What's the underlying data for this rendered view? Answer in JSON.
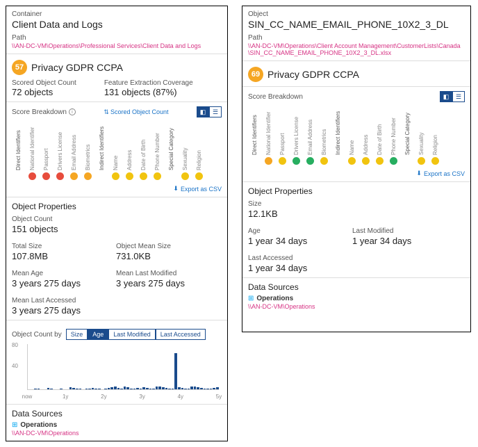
{
  "left": {
    "type_label": "Container",
    "title": "Client Data and Logs",
    "path_label": "Path",
    "path": "\\\\AN-DC-VM\\Operations\\Professional Services\\Client Data and Logs",
    "score": "57",
    "score_title": "Privacy GDPR CCPA",
    "scored_objects_label": "Scored Object Count",
    "scored_objects_value": "72 objects",
    "feature_coverage_label": "Feature Extraction Coverage",
    "feature_coverage_value": "131 objects  (87%)",
    "breakdown_label": "Score Breakdown",
    "sort_label": "Scored Object Count",
    "export_label": "Export as CSV",
    "groups": [
      {
        "group": "Direct Identifiers",
        "items": [
          {
            "label": "National Identifier",
            "color": "red"
          },
          {
            "label": "Passport",
            "color": "red"
          },
          {
            "label": "Drivers License",
            "color": "red"
          },
          {
            "label": "Email Address",
            "color": "orange"
          },
          {
            "label": "Biometrics",
            "color": "orange"
          }
        ]
      },
      {
        "group": "Indirect Identifiers",
        "items": [
          {
            "label": "Name",
            "color": "yellow"
          },
          {
            "label": "Address",
            "color": "yellow"
          },
          {
            "label": "Date of Birth",
            "color": "yellow"
          },
          {
            "label": "Phone Number",
            "color": "yellow"
          }
        ]
      },
      {
        "group": "Special Category",
        "items": [
          {
            "label": "Sexuality",
            "color": "yellow"
          },
          {
            "label": "Religion",
            "color": "yellow"
          }
        ]
      }
    ],
    "props_title": "Object Properties",
    "props": [
      {
        "lbl": "Object Count",
        "val": "151 objects"
      },
      {
        "lbl": "",
        "val": ""
      },
      {
        "lbl": "Total Size",
        "val": "107.8MB"
      },
      {
        "lbl": "Object Mean Size",
        "val": "731.0KB"
      },
      {
        "lbl": "Mean Age",
        "val": "3 years 275 days"
      },
      {
        "lbl": "Mean Last Modified",
        "val": "3 years 275 days"
      },
      {
        "lbl": "Mean Last Accessed",
        "val": "3 years 275 days"
      }
    ],
    "count_by_label": "Object Count by",
    "count_by_options": [
      "Size",
      "Age",
      "Last Modified",
      "Last Accessed"
    ],
    "count_by_active": 1,
    "ds_title": "Data Sources",
    "ds_name": "Operations",
    "ds_path": "\\\\AN-DC-VM\\Operations"
  },
  "right": {
    "type_label": "Object",
    "title": "SIN_CC_NAME_EMAIL_PHONE_10X2_3_DL",
    "path_label": "Path",
    "path": "\\\\AN-DC-VM\\Operations\\Client Account Management\\CustomerLists\\Canada\\SIN_CC_NAME_EMAIL_PHONE_10X2_3_DL.xlsx",
    "score": "69",
    "score_title": "Privacy GDPR CCPA",
    "breakdown_label": "Score Breakdown",
    "export_label": "Export as CSV",
    "groups": [
      {
        "group": "Direct Identifiers",
        "items": [
          {
            "label": "National Identifier",
            "color": "orange"
          },
          {
            "label": "Passport",
            "color": "yellow"
          },
          {
            "label": "Drivers License",
            "color": "green"
          },
          {
            "label": "Email Address",
            "color": "green"
          },
          {
            "label": "Biometrics",
            "color": "yellow"
          }
        ]
      },
      {
        "group": "Indirect Identifiers",
        "items": [
          {
            "label": "Name",
            "color": "yellow"
          },
          {
            "label": "Address",
            "color": "yellow"
          },
          {
            "label": "Date of Birth",
            "color": "yellow"
          },
          {
            "label": "Phone Number",
            "color": "green"
          }
        ]
      },
      {
        "group": "Special Category",
        "items": [
          {
            "label": "Sexuality",
            "color": "yellow"
          },
          {
            "label": "Religion",
            "color": "yellow"
          }
        ]
      }
    ],
    "props_title": "Object Properties",
    "props": [
      {
        "lbl": "Size",
        "val": "12.1KB"
      },
      {
        "lbl": "",
        "val": ""
      },
      {
        "lbl": "Age",
        "val": "1 year 34 days"
      },
      {
        "lbl": "Last Modified",
        "val": "1 year 34 days"
      },
      {
        "lbl": "Last Accessed",
        "val": "1 year 34 days"
      }
    ],
    "ds_title": "Data Sources",
    "ds_name": "Operations",
    "ds_path": "\\\\AN-DC-VM\\Operations"
  },
  "chart_data": {
    "type": "bar",
    "xlabel": "",
    "ylabel": "",
    "ylim": [
      0,
      80
    ],
    "yticks": [
      40,
      80
    ],
    "xticks": [
      "now",
      "1y",
      "2y",
      "3y",
      "4y",
      "5y"
    ],
    "values": [
      0,
      0,
      2,
      1,
      0,
      0,
      3,
      2,
      0,
      0,
      1,
      0,
      0,
      4,
      3,
      2,
      1,
      0,
      2,
      1,
      3,
      2,
      1,
      0,
      2,
      3,
      4,
      5,
      3,
      2,
      6,
      4,
      2,
      1,
      3,
      2,
      4,
      3,
      2,
      1,
      5,
      6,
      4,
      3,
      2,
      1,
      70,
      4,
      3,
      2,
      1,
      6,
      5,
      4,
      3,
      2,
      1,
      2,
      3,
      4
    ]
  }
}
